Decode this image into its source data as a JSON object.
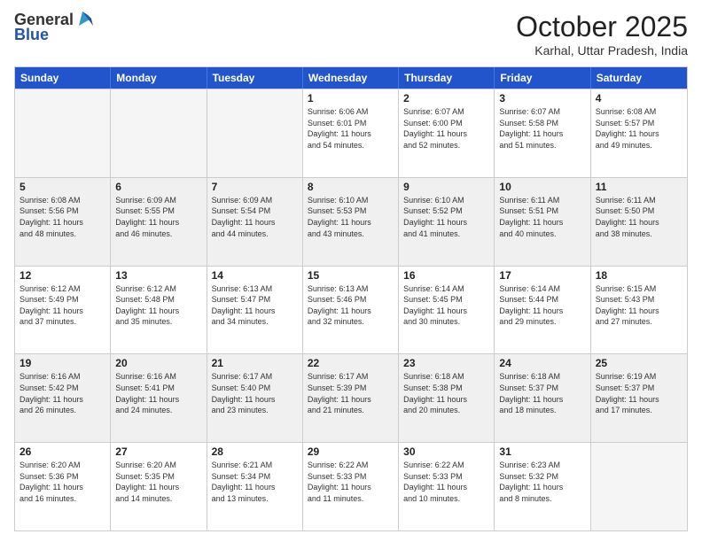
{
  "header": {
    "logo": {
      "line1": "General",
      "line2": "Blue"
    },
    "title": "October 2025",
    "location": "Karhal, Uttar Pradesh, India"
  },
  "days_of_week": [
    "Sunday",
    "Monday",
    "Tuesday",
    "Wednesday",
    "Thursday",
    "Friday",
    "Saturday"
  ],
  "weeks": [
    [
      {
        "day": "",
        "info": ""
      },
      {
        "day": "",
        "info": ""
      },
      {
        "day": "",
        "info": ""
      },
      {
        "day": "1",
        "info": "Sunrise: 6:06 AM\nSunset: 6:01 PM\nDaylight: 11 hours\nand 54 minutes."
      },
      {
        "day": "2",
        "info": "Sunrise: 6:07 AM\nSunset: 6:00 PM\nDaylight: 11 hours\nand 52 minutes."
      },
      {
        "day": "3",
        "info": "Sunrise: 6:07 AM\nSunset: 5:58 PM\nDaylight: 11 hours\nand 51 minutes."
      },
      {
        "day": "4",
        "info": "Sunrise: 6:08 AM\nSunset: 5:57 PM\nDaylight: 11 hours\nand 49 minutes."
      }
    ],
    [
      {
        "day": "5",
        "info": "Sunrise: 6:08 AM\nSunset: 5:56 PM\nDaylight: 11 hours\nand 48 minutes."
      },
      {
        "day": "6",
        "info": "Sunrise: 6:09 AM\nSunset: 5:55 PM\nDaylight: 11 hours\nand 46 minutes."
      },
      {
        "day": "7",
        "info": "Sunrise: 6:09 AM\nSunset: 5:54 PM\nDaylight: 11 hours\nand 44 minutes."
      },
      {
        "day": "8",
        "info": "Sunrise: 6:10 AM\nSunset: 5:53 PM\nDaylight: 11 hours\nand 43 minutes."
      },
      {
        "day": "9",
        "info": "Sunrise: 6:10 AM\nSunset: 5:52 PM\nDaylight: 11 hours\nand 41 minutes."
      },
      {
        "day": "10",
        "info": "Sunrise: 6:11 AM\nSunset: 5:51 PM\nDaylight: 11 hours\nand 40 minutes."
      },
      {
        "day": "11",
        "info": "Sunrise: 6:11 AM\nSunset: 5:50 PM\nDaylight: 11 hours\nand 38 minutes."
      }
    ],
    [
      {
        "day": "12",
        "info": "Sunrise: 6:12 AM\nSunset: 5:49 PM\nDaylight: 11 hours\nand 37 minutes."
      },
      {
        "day": "13",
        "info": "Sunrise: 6:12 AM\nSunset: 5:48 PM\nDaylight: 11 hours\nand 35 minutes."
      },
      {
        "day": "14",
        "info": "Sunrise: 6:13 AM\nSunset: 5:47 PM\nDaylight: 11 hours\nand 34 minutes."
      },
      {
        "day": "15",
        "info": "Sunrise: 6:13 AM\nSunset: 5:46 PM\nDaylight: 11 hours\nand 32 minutes."
      },
      {
        "day": "16",
        "info": "Sunrise: 6:14 AM\nSunset: 5:45 PM\nDaylight: 11 hours\nand 30 minutes."
      },
      {
        "day": "17",
        "info": "Sunrise: 6:14 AM\nSunset: 5:44 PM\nDaylight: 11 hours\nand 29 minutes."
      },
      {
        "day": "18",
        "info": "Sunrise: 6:15 AM\nSunset: 5:43 PM\nDaylight: 11 hours\nand 27 minutes."
      }
    ],
    [
      {
        "day": "19",
        "info": "Sunrise: 6:16 AM\nSunset: 5:42 PM\nDaylight: 11 hours\nand 26 minutes."
      },
      {
        "day": "20",
        "info": "Sunrise: 6:16 AM\nSunset: 5:41 PM\nDaylight: 11 hours\nand 24 minutes."
      },
      {
        "day": "21",
        "info": "Sunrise: 6:17 AM\nSunset: 5:40 PM\nDaylight: 11 hours\nand 23 minutes."
      },
      {
        "day": "22",
        "info": "Sunrise: 6:17 AM\nSunset: 5:39 PM\nDaylight: 11 hours\nand 21 minutes."
      },
      {
        "day": "23",
        "info": "Sunrise: 6:18 AM\nSunset: 5:38 PM\nDaylight: 11 hours\nand 20 minutes."
      },
      {
        "day": "24",
        "info": "Sunrise: 6:18 AM\nSunset: 5:37 PM\nDaylight: 11 hours\nand 18 minutes."
      },
      {
        "day": "25",
        "info": "Sunrise: 6:19 AM\nSunset: 5:37 PM\nDaylight: 11 hours\nand 17 minutes."
      }
    ],
    [
      {
        "day": "26",
        "info": "Sunrise: 6:20 AM\nSunset: 5:36 PM\nDaylight: 11 hours\nand 16 minutes."
      },
      {
        "day": "27",
        "info": "Sunrise: 6:20 AM\nSunset: 5:35 PM\nDaylight: 11 hours\nand 14 minutes."
      },
      {
        "day": "28",
        "info": "Sunrise: 6:21 AM\nSunset: 5:34 PM\nDaylight: 11 hours\nand 13 minutes."
      },
      {
        "day": "29",
        "info": "Sunrise: 6:22 AM\nSunset: 5:33 PM\nDaylight: 11 hours\nand 11 minutes."
      },
      {
        "day": "30",
        "info": "Sunrise: 6:22 AM\nSunset: 5:33 PM\nDaylight: 11 hours\nand 10 minutes."
      },
      {
        "day": "31",
        "info": "Sunrise: 6:23 AM\nSunset: 5:32 PM\nDaylight: 11 hours\nand 8 minutes."
      },
      {
        "day": "",
        "info": ""
      }
    ]
  ]
}
